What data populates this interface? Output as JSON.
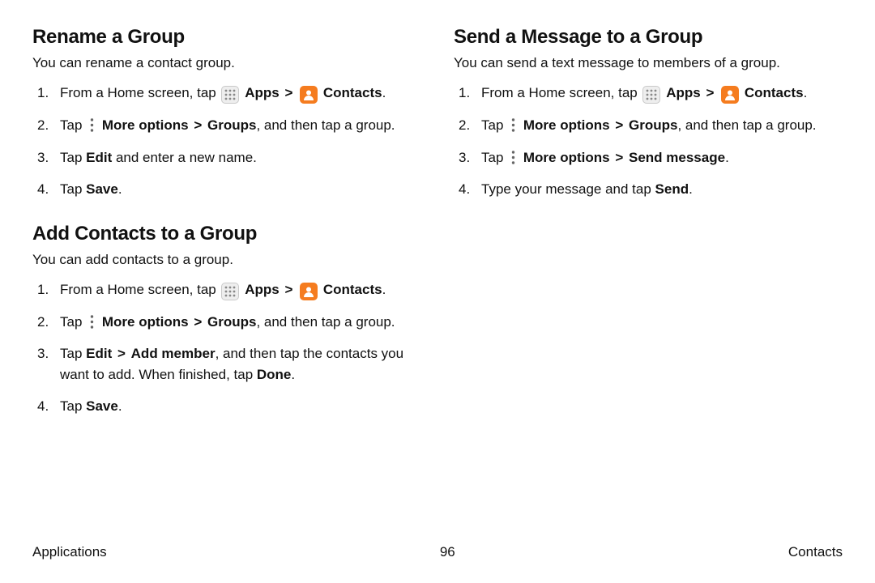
{
  "left": {
    "rename": {
      "heading": "Rename a Group",
      "intro": "You can rename a contact group.",
      "steps": {
        "s1_a": "From a Home screen, tap ",
        "s1_apps": "Apps",
        "s1_contacts": "Contacts",
        "s2_a": "Tap ",
        "s2_b": "More options",
        "s2_c": "Groups",
        "s2_d": ", and then tap a group.",
        "s3_a": "Tap ",
        "s3_b": "Edit",
        "s3_c": " and enter a new name.",
        "s4_a": "Tap ",
        "s4_b": "Save",
        "s4_c": "."
      }
    },
    "add": {
      "heading": "Add Contacts to a Group",
      "intro": "You can add contacts to a group.",
      "steps": {
        "s1_a": "From a Home screen, tap ",
        "s1_apps": "Apps",
        "s1_contacts": "Contacts",
        "s2_a": "Tap ",
        "s2_b": "More options",
        "s2_c": "Groups",
        "s2_d": ", and then tap a group.",
        "s3_a": "Tap ",
        "s3_b": "Edit",
        "s3_c": "Add member",
        "s3_d": ", and then tap the contacts you want to add. When finished, tap ",
        "s3_e": "Done",
        "s3_f": ".",
        "s4_a": "Tap ",
        "s4_b": "Save",
        "s4_c": "."
      }
    }
  },
  "right": {
    "send": {
      "heading": "Send a Message to a Group",
      "intro": "You can send a text message to members of a group.",
      "steps": {
        "s1_a": "From a Home screen, tap ",
        "s1_apps": "Apps",
        "s1_contacts": "Contacts",
        "s2_a": "Tap ",
        "s2_b": "More options",
        "s2_c": "Groups",
        "s2_d": ", and then tap a group.",
        "s3_a": "Tap ",
        "s3_b": "More options",
        "s3_c": "Send message",
        "s3_d": ".",
        "s4_a": "Type your message and tap ",
        "s4_b": "Send",
        "s4_c": "."
      }
    }
  },
  "footer": {
    "left": "Applications",
    "page": "96",
    "right": "Contacts"
  },
  "glyphs": {
    "chevron": ">",
    "period": "."
  }
}
